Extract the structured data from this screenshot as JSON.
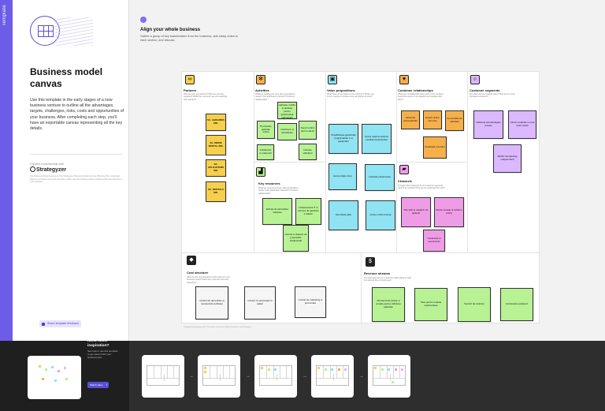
{
  "side_tab": {
    "label": "Template"
  },
  "info": {
    "title": "Business model canvas",
    "description": "Use this template in the early stages of a new business venture to outline all the advantages, targets, challenges, risks, costs and opportunities of your business. After completing each step, you'll have an exportable canvas representing all the key details.",
    "created_label": "Created in partnership with",
    "partner_name": "Strategyzer",
    "fineprint": "The Business Model Canvas by The Strategyzer Business Model Canvas (Plus free fill-in materials). Used as a creative tool of the business model. Use this working model to outline all the key features of your business.",
    "feedback_label": "Share template feedback"
  },
  "canvas": {
    "title": "Align your whole business",
    "subtitle": "Gather a group of key stakeholders from the business, add sticky notes to each section, and discuss"
  },
  "sections": {
    "partners": {
      "title": "Partners",
      "icon": "link-icon",
      "q": "Who are your key partners? Who are your key suppliers? Which key resources are you acquiring from partners?"
    },
    "activities": {
      "title": "Activities",
      "icon": "gear-icon",
      "q": "What key activities do your value propositions require? Our distribution channels? Customer relationships?"
    },
    "resources": {
      "title": "Key resources",
      "icon": "factory-icon",
      "q": "What key resources do our value propositions require? Our distribution channels? Customer relationships?"
    },
    "value": {
      "title": "Value propositions",
      "icon": "gift-icon",
      "q": "What value do we deliver to the customer? Which one of our customer's problems are we helping to solve?"
    },
    "relationships": {
      "title": "Customer relationships",
      "icon": "heart-icon",
      "q": "What type of relationship does each of our customer segments expect us to establish and maintain with them?"
    },
    "channels": {
      "title": "Channels",
      "icon": "truck-icon",
      "q": "Through which channels do our customer segments want to be reached? How are we reaching them now?"
    },
    "segments": {
      "title": "Customer segments",
      "icon": "person-icon",
      "q": "For whom are we creating value? Who are our most important customers?"
    },
    "costs": {
      "title": "Cost structure",
      "icon": "tag-icon",
      "q": "What are the most important costs inherent in our business model? Which key resources are most expensive?"
    },
    "revenue": {
      "title": "Revenue streams",
      "icon": "money-bag-icon",
      "q": "For what value are our customers really willing to pay? For what do they currently pay?"
    }
  },
  "notes": {
    "partners": [
      "SC. LIBRARIES SRL",
      "SC. MEDIS DENTAL SRL",
      "SC. APLICATIONS SRL",
      "SC. DENTALX SRL"
    ],
    "activities": [
      "Dezvoltare aplicatie mobila si desktop pentru gestionarea cabinetului",
      "Promovare aplicatie online",
      "Intretinere si actualizare",
      "Suport tehnic pentru clienti",
      "Colaborare cu parteneri",
      "Instruire utilizatori"
    ],
    "resources": [
      "Echipa de dezvoltare software",
      "Infrastructura IT si servere de gazduire a datelor",
      "Licente si drepturi de proprietate intelectuala"
    ],
    "value": [
      "Simplificarea gestionarii programarilor si a pacientilor",
      "Acces rapid la istoricul medical al pacientilor",
      "Economisire timp",
      "Interfata prietenoasa",
      "Securitate date",
      "Acces mobil oriunde"
    ],
    "relationships": [
      "Asistenta personalizata",
      "Suport online non-stop",
      "Comunitate de utilizatori",
      "Feedback constant"
    ],
    "channels": [
      "Site web si magazin de aplicatii",
      "Retele sociale si reclame online",
      "Conferinte si evenimente"
    ],
    "segments": [
      "Cabinete stomatologice private",
      "Clinici medicale cu mai multi medici",
      "Medici stomatologi independenti"
    ],
    "costs": [
      "Costuri de dezvoltare si mentenanta software",
      "Costuri cu personalul si salarii",
      "Costuri de marketing si promovare"
    ],
    "revenue": [
      "Abonamente lunare si anuale pentru utilizarea aplicatiei",
      "Taxe pentru module suplimentare",
      "Servicii de instruire",
      "Comisioane parteneri"
    ]
  },
  "board_footer": "Designed by Strategyzer AG. The makers of Business Model Generation and Strategyzer.",
  "bottom": {
    "title": "Need some inspiration?",
    "text": "See how to use this template to get started with your business plan.",
    "button": "Watch video"
  }
}
